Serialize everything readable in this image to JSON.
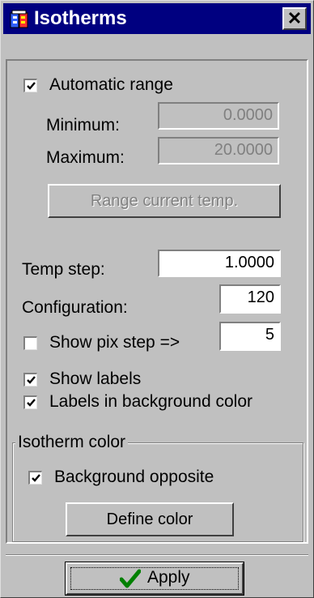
{
  "window": {
    "title": "Isotherms",
    "close_glyph": "✕",
    "app_icon": "isotherm-app-icon"
  },
  "range": {
    "automatic_label": "Automatic range",
    "automatic_checked": true,
    "minimum_label": "Minimum:",
    "minimum_value": "0.0000",
    "maximum_label": "Maximum:",
    "maximum_value": "20.0000",
    "range_button_label": "Range current temp."
  },
  "settings": {
    "temp_step_label": "Temp step:",
    "temp_step_value": "1.0000",
    "configuration_label": "Configuration:",
    "configuration_value": "120",
    "show_pix_step_label": "Show pix step =>",
    "show_pix_step_checked": false,
    "pix_step_value": "5",
    "show_labels_label": "Show labels",
    "show_labels_checked": true,
    "labels_bg_label": "Labels in background color",
    "labels_bg_checked": true
  },
  "isotherm_color": {
    "group_label": "Isotherm color",
    "background_opposite_label": "Background opposite",
    "background_opposite_checked": true,
    "define_color_label": "Define color"
  },
  "footer": {
    "apply_label": "Apply",
    "apply_icon": "checkmark-icon",
    "apply_icon_color": "#008000"
  },
  "colors": {
    "titlebar": "#000080",
    "face": "#c0c0c0"
  }
}
